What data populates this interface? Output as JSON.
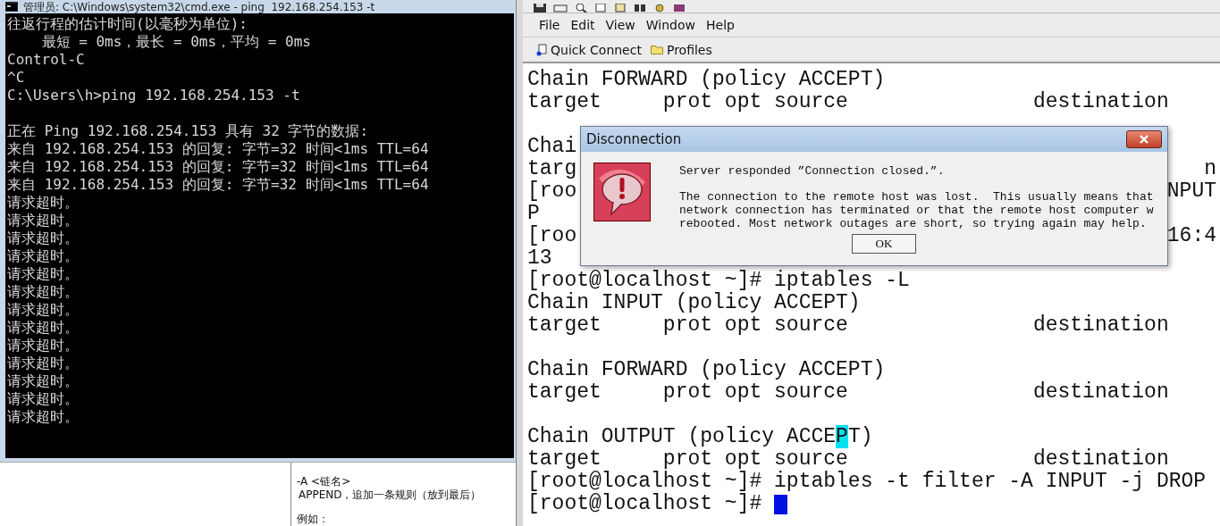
{
  "cmd_window": {
    "title": "管理员: C:\\Windows\\system32\\cmd.exe - ping  192.168.254.153 -t",
    "lines": [
      {
        "text": "往返行程的估计时间(以毫秒为单位):"
      },
      {
        "text": "    最短 = 0ms，最长 = 0ms，平均 = 0ms"
      },
      {
        "text": "Control-C"
      },
      {
        "text": "^C"
      },
      {
        "text": "C:\\Users\\h>ping 192.168.254.153 -t"
      },
      {
        "kind": "blank"
      },
      {
        "text": "正在 Ping 192.168.254.153 具有 32 字节的数据:"
      },
      {
        "text": "来自 192.168.254.153 的回复: 字节=32 时间<1ms TTL=64"
      },
      {
        "text": "来自 192.168.254.153 的回复: 字节=32 时间<1ms TTL=64"
      },
      {
        "text": "来自 192.168.254.153 的回复: 字节=32 时间<1ms TTL=64"
      },
      {
        "text": "请求超时。"
      },
      {
        "text": "请求超时。"
      },
      {
        "text": "请求超时。"
      },
      {
        "text": "请求超时。"
      },
      {
        "text": "请求超时。"
      },
      {
        "text": "请求超时。"
      },
      {
        "text": "请求超时。"
      },
      {
        "text": "请求超时。"
      },
      {
        "text": "请求超时。"
      },
      {
        "text": "请求超时。"
      },
      {
        "text": "请求超时。"
      },
      {
        "text": "请求超时。"
      },
      {
        "text": "请求超时。"
      }
    ]
  },
  "doc_panel": {
    "lines": [
      "-A <链名>",
      "APPEND，追加一条规则（放到最后）",
      "例如："
    ]
  },
  "crt_window": {
    "menu": [
      {
        "label": "File"
      },
      {
        "label": "Edit"
      },
      {
        "label": "View"
      },
      {
        "label": "Window"
      },
      {
        "label": "Help"
      }
    ],
    "buttons": [
      {
        "label": "Quick Connect",
        "kind": "connect"
      },
      {
        "label": "Profiles",
        "kind": "folder"
      }
    ],
    "terminal": [
      {
        "text": "Chain FORWARD (policy ACCEPT)"
      },
      {
        "text": "target     prot opt source               destination"
      },
      {
        "kind": "blank"
      },
      {
        "text": "Chai"
      },
      {
        "text": "targ",
        "tail": "n"
      },
      {
        "text": "[roo",
        "tail": "NPUT"
      },
      {
        "text": "P"
      },
      {
        "text": "[roo",
        "tail": "16:4"
      },
      {
        "text": "13"
      },
      {
        "text": "[root@localhost ~]# iptables -L"
      },
      {
        "text": "Chain INPUT (policy ACCEPT)"
      },
      {
        "text": "target     prot opt source               destination"
      },
      {
        "kind": "blank"
      },
      {
        "text": "Chain FORWARD (policy ACCEPT)"
      },
      {
        "text": "target     prot opt source               destination"
      },
      {
        "kind": "blank"
      },
      {
        "segments": [
          {
            "text": "Chain OUTPUT (policy ACCE",
            "highlighted": false
          },
          {
            "text": "P",
            "highlighted": true
          },
          {
            "text": "T)",
            "highlighted": false
          }
        ]
      },
      {
        "text": "target     prot opt source               destination"
      },
      {
        "text": "[root@localhost ~]# iptables -t filter -A INPUT -j DROP"
      },
      {
        "text": "[root@localhost ~]#",
        "cursor": true
      }
    ]
  },
  "dialog": {
    "title": "Disconnection",
    "message": "Server responded ”Connection closed.”.",
    "detail": [
      "The connection to the remote host was lost.  This usually means that",
      "network connection has terminated or that the remote host computer w",
      "rebooted. Most network outages are short, so trying again may help."
    ],
    "button": "OK"
  }
}
